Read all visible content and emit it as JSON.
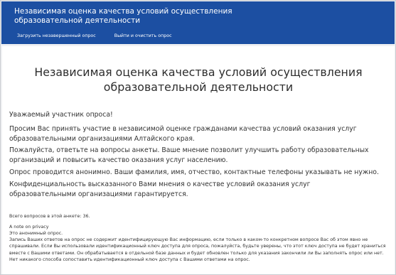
{
  "header": {
    "title": "Независимая оценка качества условий осуществления образовательной деятельности",
    "nav": [
      {
        "label": "Загрузить незавершенный опрос"
      },
      {
        "label": "Выйти и очистить опрос"
      }
    ]
  },
  "main": {
    "title": "Независимая оценка качества условий осуществления образовательной деятельности",
    "greeting": "Уважаемый участник опроса!",
    "paragraphs": [
      "Просим Вас принять участие в независимой оценке гражданами качества условий оказания услуг образовательными организациями Алтайского края.",
      "Пожалуйста, ответьте на вопросы анкеты. Ваше мнение позволит улучшить работу образовательных организаций и повысить качество оказания услуг населению.",
      "Опрос проводится анонимно. Ваши фамилия, имя, отчество, контактные телефоны указывать не нужно.",
      "Конфиденциальность высказанного Вами мнения о качестве условий оказания услуг образовательными организациями гарантируется."
    ],
    "question_count": "Всего вопросов в этой анкете: 36.",
    "privacy": {
      "heading": "A note on privacy",
      "line1": "Это анонимный опрос.",
      "body": "Запись Ваших ответов на опрос не содержит идентифицирующую Вас информацию, если только в каком-то конкретном вопросе Вас об этом явно не спрашивали. Если Вы использовали идентификационный ключ доступа для опроса, пожалуйста, будьте уверены, что этот ключ доступа не будет храниться вместе с Вашими ответами. Он обрабатывается в отдельной базе данных и будет обновлен только для указания закончили ли Вы заполнять опрос или нет. Нет никакого способа сопоставить идентификационный ключ доступа с Вашими ответами на опрос."
    }
  },
  "colors": {
    "header_bg": "#1c4fa2",
    "page_bg": "#f0f1f3",
    "content_bg": "#ffffff",
    "text": "#333333"
  }
}
